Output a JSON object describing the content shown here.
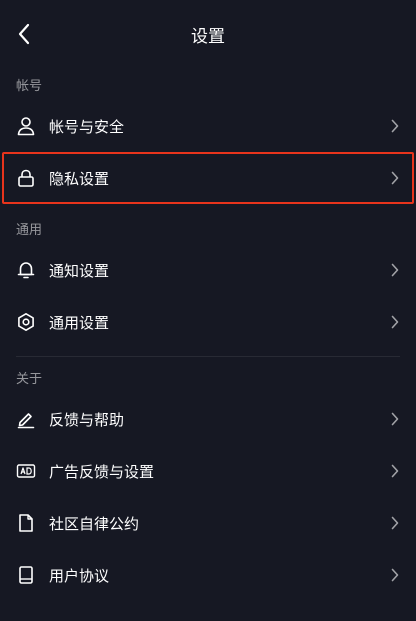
{
  "header": {
    "title": "设置"
  },
  "sections": [
    {
      "label": "帐号",
      "items": [
        {
          "label": "帐号与安全",
          "icon": "user-icon"
        },
        {
          "label": "隐私设置",
          "icon": "lock-icon",
          "highlighted": true
        }
      ]
    },
    {
      "label": "通用",
      "items": [
        {
          "label": "通知设置",
          "icon": "bell-icon"
        },
        {
          "label": "通用设置",
          "icon": "gear-icon"
        }
      ]
    },
    {
      "label": "关于",
      "items": [
        {
          "label": "反馈与帮助",
          "icon": "pencil-icon"
        },
        {
          "label": "广告反馈与设置",
          "icon": "ad-icon"
        },
        {
          "label": "社区自律公约",
          "icon": "document-icon"
        },
        {
          "label": "用户协议",
          "icon": "book-icon"
        }
      ]
    }
  ],
  "colors": {
    "background": "#161823",
    "highlight": "#e8341c",
    "text": "#ffffff"
  }
}
